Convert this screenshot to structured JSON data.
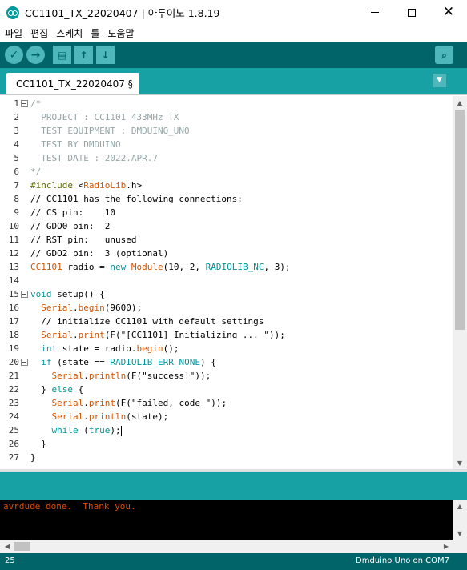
{
  "window": {
    "title": "CC1101_TX_22020407 | 아두이노 1.8.19",
    "min_symbol": "",
    "max_symbol": "",
    "close_symbol": "✕"
  },
  "menu": [
    "파일",
    "편집",
    "스케치",
    "툴",
    "도움말"
  ],
  "toolbar": {
    "verify_glyph": "✓",
    "upload_glyph": "→",
    "new_glyph": "▤",
    "open_glyph": "↑",
    "save_glyph": "↓",
    "serial_glyph": "⌕"
  },
  "tab": {
    "label": "CC1101_TX_22020407 §",
    "menu_glyph": "▼"
  },
  "editor": {
    "line_numbers": [
      "1",
      "2",
      "3",
      "4",
      "5",
      "6",
      "7",
      "8",
      "9",
      "10",
      "11",
      "12",
      "13",
      "14",
      "15",
      "16",
      "17",
      "18",
      "19",
      "20",
      "21",
      "22",
      "23",
      "24",
      "25",
      "26",
      "27"
    ],
    "fold_lines": [
      1,
      15,
      20
    ],
    "lines": [
      [
        {
          "t": "/*",
          "c": "cm"
        }
      ],
      [
        {
          "t": "  PROJECT : CC1101 433MHz_TX",
          "c": "cm"
        }
      ],
      [
        {
          "t": "  TEST EQUIPMENT : DMDUINO_UNO",
          "c": "cm"
        }
      ],
      [
        {
          "t": "  TEST BY DMDUINO",
          "c": "cm"
        }
      ],
      [
        {
          "t": "  TEST DATE : 2022.APR.7",
          "c": "cm"
        }
      ],
      [
        {
          "t": "*/",
          "c": "cm"
        }
      ],
      [
        {
          "t": "#include ",
          "c": "pp"
        },
        {
          "t": "<",
          "c": ""
        },
        {
          "t": "RadioLib",
          "c": "ty"
        },
        {
          "t": ".h>",
          "c": ""
        }
      ],
      [
        {
          "t": "// CC1101 has the following connections:",
          "c": ""
        }
      ],
      [
        {
          "t": "// CS pin:    10",
          "c": ""
        }
      ],
      [
        {
          "t": "// GDO0 pin:  2",
          "c": ""
        }
      ],
      [
        {
          "t": "// RST pin:   unused",
          "c": ""
        }
      ],
      [
        {
          "t": "// GDO2 pin:  3 (optional)",
          "c": ""
        }
      ],
      [
        {
          "t": "CC1101",
          "c": "ty"
        },
        {
          "t": " radio = ",
          "c": ""
        },
        {
          "t": "new",
          "c": "kw"
        },
        {
          "t": " ",
          "c": ""
        },
        {
          "t": "Module",
          "c": "ty"
        },
        {
          "t": "(10, 2, ",
          "c": ""
        },
        {
          "t": "RADIOLIB_NC",
          "c": "cons"
        },
        {
          "t": ", 3);",
          "c": ""
        }
      ],
      [
        {
          "t": "",
          "c": ""
        }
      ],
      [
        {
          "t": "void",
          "c": "kw"
        },
        {
          "t": " setup() {",
          "c": ""
        }
      ],
      [
        {
          "t": "  ",
          "c": ""
        },
        {
          "t": "Serial",
          "c": "ty"
        },
        {
          "t": ".",
          "c": ""
        },
        {
          "t": "begin",
          "c": "ty"
        },
        {
          "t": "(9600);",
          "c": ""
        }
      ],
      [
        {
          "t": "  // initialize CC1101 with default settings",
          "c": ""
        }
      ],
      [
        {
          "t": "  ",
          "c": ""
        },
        {
          "t": "Serial",
          "c": "ty"
        },
        {
          "t": ".",
          "c": ""
        },
        {
          "t": "print",
          "c": "ty"
        },
        {
          "t": "(F(\"[CC1101] Initializing ... \"));",
          "c": ""
        }
      ],
      [
        {
          "t": "  ",
          "c": ""
        },
        {
          "t": "int",
          "c": "kw"
        },
        {
          "t": " state = radio.",
          "c": ""
        },
        {
          "t": "begin",
          "c": "ty"
        },
        {
          "t": "();",
          "c": ""
        }
      ],
      [
        {
          "t": "  ",
          "c": ""
        },
        {
          "t": "if",
          "c": "kw"
        },
        {
          "t": " (state == ",
          "c": ""
        },
        {
          "t": "RADIOLIB_ERR_NONE",
          "c": "cons"
        },
        {
          "t": ") {",
          "c": ""
        }
      ],
      [
        {
          "t": "    ",
          "c": ""
        },
        {
          "t": "Serial",
          "c": "ty"
        },
        {
          "t": ".",
          "c": ""
        },
        {
          "t": "println",
          "c": "ty"
        },
        {
          "t": "(F(\"success!\"));",
          "c": ""
        }
      ],
      [
        {
          "t": "  } ",
          "c": ""
        },
        {
          "t": "else",
          "c": "kw"
        },
        {
          "t": " {",
          "c": ""
        }
      ],
      [
        {
          "t": "    ",
          "c": ""
        },
        {
          "t": "Serial",
          "c": "ty"
        },
        {
          "t": ".",
          "c": ""
        },
        {
          "t": "print",
          "c": "ty"
        },
        {
          "t": "(F(\"failed, code \"));",
          "c": ""
        }
      ],
      [
        {
          "t": "    ",
          "c": ""
        },
        {
          "t": "Serial",
          "c": "ty"
        },
        {
          "t": ".",
          "c": ""
        },
        {
          "t": "println",
          "c": "ty"
        },
        {
          "t": "(state);",
          "c": ""
        }
      ],
      [
        {
          "t": "    ",
          "c": ""
        },
        {
          "t": "while",
          "c": "kw"
        },
        {
          "t": " (",
          "c": ""
        },
        {
          "t": "true",
          "c": "kw"
        },
        {
          "t": ");",
          "c": ""
        },
        {
          "t": "|CURSOR|",
          "c": "cursor"
        }
      ],
      [
        {
          "t": "  }",
          "c": ""
        }
      ],
      [
        {
          "t": "}",
          "c": ""
        }
      ]
    ]
  },
  "scroll": {
    "up_glyph": "▲",
    "down_glyph": "▼",
    "left_glyph": "◀",
    "right_glyph": "▶"
  },
  "console": {
    "text": "avrdude done.  Thank you."
  },
  "statusbar": {
    "line": "25",
    "board": "Dmduino Uno on COM7"
  },
  "colors": {
    "toolbar": "#006468",
    "tabbar": "#17a1a5",
    "console_text": "#e34c00"
  }
}
